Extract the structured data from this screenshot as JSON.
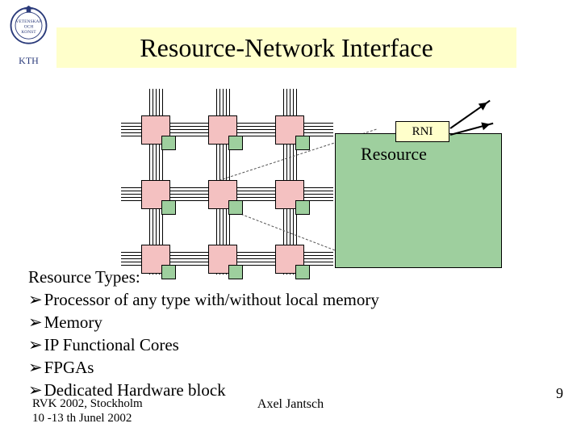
{
  "header": {
    "title": "Resource-Network Interface",
    "logo_label": "KTH"
  },
  "diagram": {
    "rni_label": "RNI",
    "resource_label": "Resource"
  },
  "body": {
    "heading": "Resource Types:",
    "bullets": [
      "Processor of any type with/without local memory",
      "Memory",
      "IP Functional Cores",
      "FPGAs",
      "Dedicated Hardware block"
    ]
  },
  "footer": {
    "left_line1": "RVK 2002, Stockholm",
    "left_line2": "10 -13 th Junel 2002",
    "center": "Axel Jantsch",
    "page_number": "9"
  }
}
